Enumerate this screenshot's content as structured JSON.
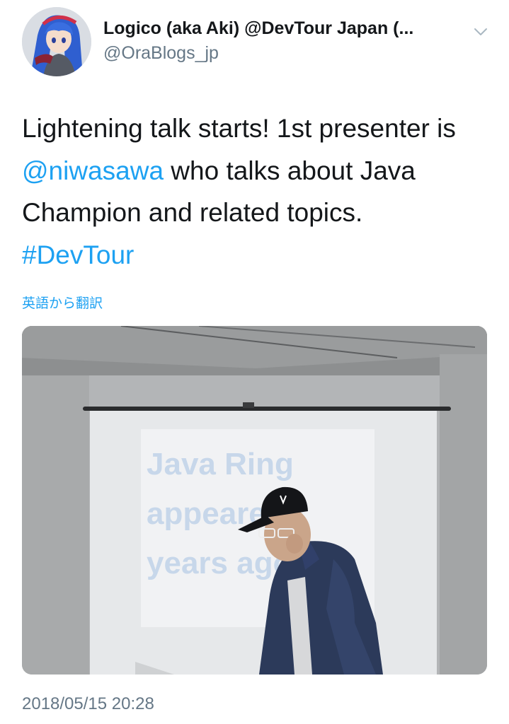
{
  "tweet": {
    "author": {
      "display_name": "Logico (aka Aki) @DevTour Japan (...",
      "handle": "@OraBlogs_jp"
    },
    "text": {
      "line1": "Lightening talk starts! 1st presenter is",
      "mention": "@niwasawa",
      "after_mention": " who talks about Java",
      "line3": "Champion and related topics.",
      "hashtag": "#DevTour"
    },
    "translate_label": "英語から翻訳",
    "photo": {
      "slide_lines": [
        "Java Ring",
        "appeared",
        "years ago."
      ]
    },
    "timestamp": "2018/05/15 20:28"
  },
  "colors": {
    "link": "#1da1f2",
    "text": "#14171a",
    "secondary": "#657786"
  },
  "icons": {
    "more": "chevron-down-icon"
  }
}
